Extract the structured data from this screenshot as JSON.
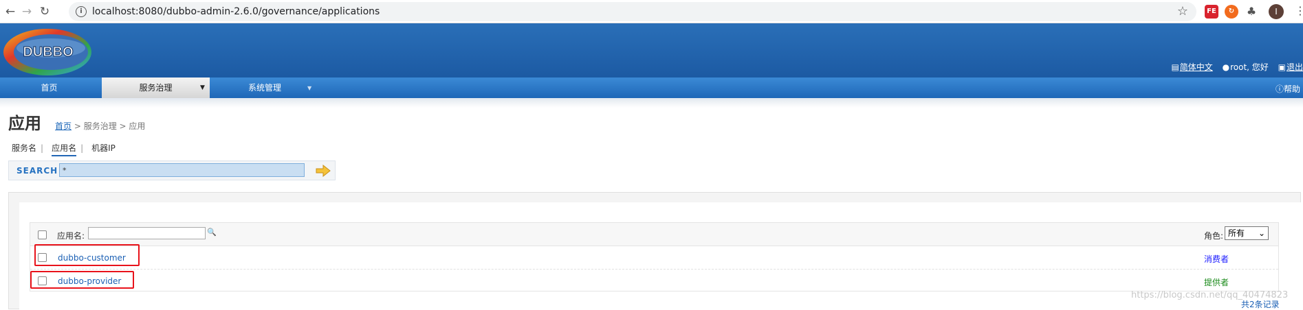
{
  "browser": {
    "url": "localhost:8080/dubbo-admin-2.6.0/governance/applications",
    "profile_initial": "I"
  },
  "header": {
    "logo_text": "DUBBO",
    "links": {
      "language": "简体中文",
      "user": "root, 您好",
      "logout": "退出"
    }
  },
  "menu": {
    "items": [
      {
        "label": "首页"
      },
      {
        "label": "服务治理"
      },
      {
        "label": "系统管理"
      }
    ],
    "help": "帮助"
  },
  "page": {
    "title": "应用",
    "breadcrumb": {
      "home": "首页",
      "rest": " > 服务治理 > 应用"
    },
    "tabs": [
      "服务名",
      "应用名",
      "机器IP"
    ],
    "tab_sep": "|",
    "search_label": "SEARCH",
    "search_value": "*"
  },
  "table": {
    "col_app": "应用名:",
    "col_role": "角色:",
    "role_selected": "所有",
    "rows": [
      {
        "name": "dubbo-customer",
        "role": "消费者",
        "role_color": "#1a1aff"
      },
      {
        "name": "dubbo-provider",
        "role": "提供者",
        "role_color": "#1a8a1a"
      }
    ],
    "total": "共2条记录"
  },
  "watermark": "https://blog.csdn.net/qq_40474823",
  "colors": {
    "header": "#1f5da6",
    "menu": "#2874c4",
    "highlight": "#e8121a"
  }
}
